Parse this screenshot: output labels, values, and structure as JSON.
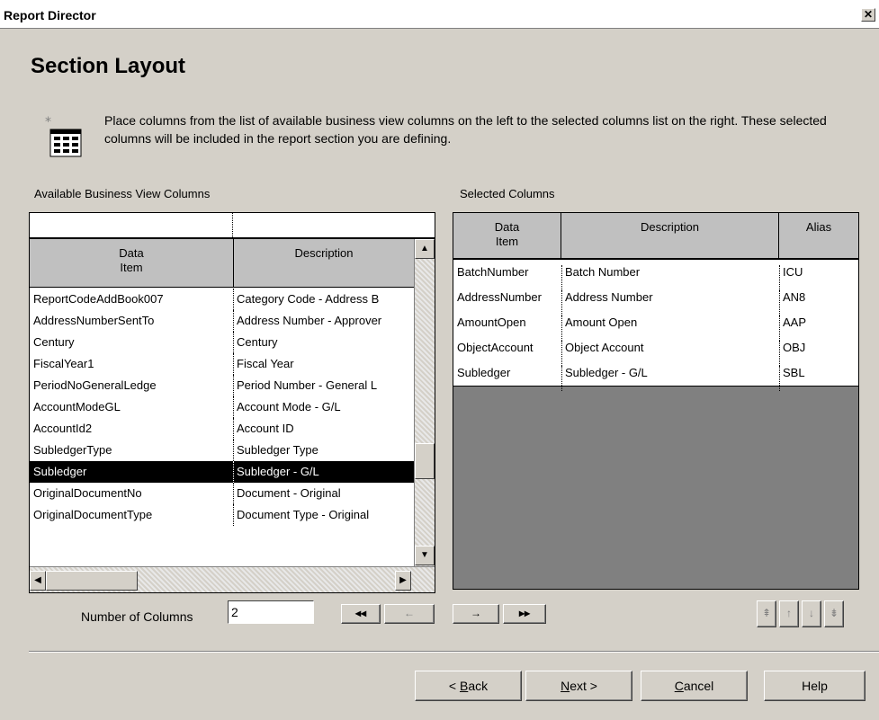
{
  "window": {
    "title": "Report Director",
    "close_glyph": "✕"
  },
  "page": {
    "title": "Section Layout",
    "instructions": "Place columns from the list of available business view columns on the left to the selected columns list on the right. These selected columns will be included in the report section you are defining."
  },
  "available": {
    "label": "Available Business View Columns",
    "headers": {
      "data_item": "Data\nItem",
      "description": "Description"
    },
    "rows": [
      {
        "item": "ReportCodeAddBook007",
        "desc": "Category Code - Address B"
      },
      {
        "item": "AddressNumberSentTo",
        "desc": "Address Number - Approver"
      },
      {
        "item": "Century",
        "desc": "Century"
      },
      {
        "item": "FiscalYear1",
        "desc": "Fiscal Year"
      },
      {
        "item": "PeriodNoGeneralLedge",
        "desc": "Period Number - General L"
      },
      {
        "item": "AccountModeGL",
        "desc": "Account Mode - G/L"
      },
      {
        "item": "AccountId2",
        "desc": "Account ID"
      },
      {
        "item": "SubledgerType",
        "desc": "Subledger Type"
      },
      {
        "item": "Subledger",
        "desc": "Subledger - G/L"
      },
      {
        "item": "OriginalDocumentNo",
        "desc": "Document - Original"
      },
      {
        "item": "OriginalDocumentType",
        "desc": "Document Type - Original"
      }
    ],
    "selected_row": 8
  },
  "selected": {
    "label": "Selected Columns",
    "headers": {
      "data_item": "Data\nItem",
      "description": "Description",
      "alias": "Alias"
    },
    "rows": [
      {
        "item": "BatchNumber",
        "desc": "Batch Number",
        "alias": "ICU"
      },
      {
        "item": "AddressNumber",
        "desc": "Address Number",
        "alias": "AN8"
      },
      {
        "item": "AmountOpen",
        "desc": "Amount Open",
        "alias": "AAP"
      },
      {
        "item": "ObjectAccount",
        "desc": "Object Account",
        "alias": "OBJ"
      },
      {
        "item": "Subledger",
        "desc": "Subledger - G/L",
        "alias": "SBL"
      }
    ]
  },
  "number_of_columns": {
    "label": "Number of Columns",
    "value": "2"
  },
  "transfer": {
    "remove_all": "◂◂",
    "remove": "←",
    "add": "→",
    "add_all": "▸▸"
  },
  "order": {
    "top": "⇞",
    "up": "↑",
    "down": "↓",
    "bottom": "⇟"
  },
  "buttons": {
    "back_prefix": "< ",
    "back_key": "B",
    "back_rest": "ack",
    "next_key": "N",
    "next_rest": "ext >",
    "cancel_key": "C",
    "cancel_rest": "ancel",
    "help": "Help"
  }
}
